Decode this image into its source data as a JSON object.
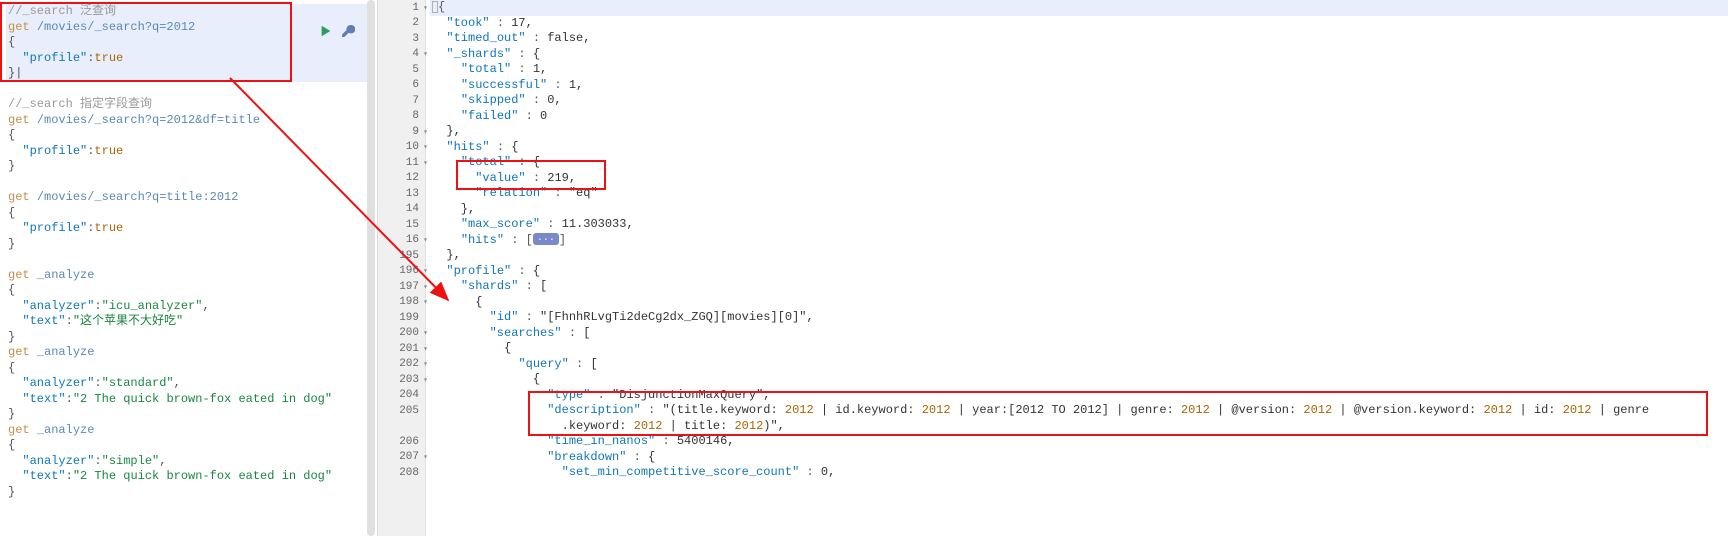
{
  "left": {
    "block1": {
      "comment": "//_search 泛查询",
      "req": "get /movies/_search?q=2012",
      "body_key": "\"profile\"",
      "body_val": "true"
    },
    "block2": {
      "comment": "//_search 指定字段查询",
      "req": "get /movies/_search?q=2012&df=title",
      "body_key": "\"profile\"",
      "body_val": "true"
    },
    "block3": {
      "req": "get /movies/_search?q=title:2012",
      "body_key": "\"profile\"",
      "body_val": "true"
    },
    "block4": {
      "req": "get _analyze",
      "k1": "\"analyzer\"",
      "v1": "\"icu_analyzer\"",
      "k2": "\"text\"",
      "v2": "\"这个苹果不大好吃\""
    },
    "block5": {
      "req": "get _analyze",
      "k1": "\"analyzer\"",
      "v1": "\"standard\"",
      "k2": "\"text\"",
      "v2": "\"2 The quick brown-fox eated in dog\""
    },
    "block6": {
      "req": "get _analyze",
      "k1": "\"analyzer\"",
      "v1": "\"simple\"",
      "k2": "\"text\"",
      "v2": "\"2 The quick brown-fox eated in dog\""
    }
  },
  "gutter": [
    "1",
    "2",
    "3",
    "4",
    "5",
    "6",
    "7",
    "8",
    "9",
    "10",
    "11",
    "12",
    "13",
    "14",
    "15",
    "16",
    "195",
    "196",
    "197",
    "198",
    "199",
    "200",
    "201",
    "202",
    "203",
    "204",
    "205",
    "",
    "206",
    "207",
    "208"
  ],
  "right": {
    "took": "\"took\" : 17,",
    "timed_out": "\"timed_out\" : false,",
    "shards": "\"_shards\" : {",
    "shards_total": "\"total\" : 1,",
    "shards_successful": "\"successful\" : 1,",
    "shards_skipped": "\"skipped\" : 0,",
    "shards_failed": "\"failed\" : 0",
    "close": "},",
    "hits": "\"hits\" : {",
    "hits_total": "\"total\" : {",
    "hits_value": "\"value\" : 219,",
    "hits_relation": "\"relation\" : \"eq\"",
    "hits_close": "},",
    "max_score": "\"max_score\" : 11.303033,",
    "hits_arr": "\"hits\" : [",
    "hits_arr_close": "]",
    "folded": "...",
    "hits_outer_close": "},",
    "profile": "\"profile\" : {",
    "shards2": "\"shards\" : [",
    "obj": "{",
    "id": "\"id\" : \"[FhnhRLvgTi2deCg2dx_ZGQ][movies][0]\",",
    "searches": "\"searches\" : [",
    "obj2": "{",
    "query": "\"query\" : [",
    "obj3": "{",
    "type": "\"type\" : \"DisjunctionMaxQuery\",",
    "desc_a": "\"description\" : \"(title.keyword:2012 | id.keyword:2012 | year:[2012 TO 2012] | genre:2012 | @version:2012 | @version.keyword:2012 | id:2012 | genre",
    "desc_b": ".keyword:2012 | title:2012)\",",
    "time": "\"time_in_nanos\" : 5400146,",
    "breakdown": "\"breakdown\" : {",
    "set_min": "\"set_min_competitive_score_count\" : 0,"
  }
}
